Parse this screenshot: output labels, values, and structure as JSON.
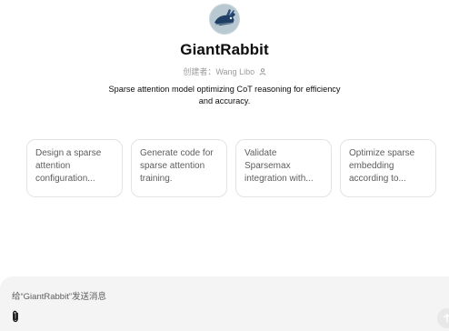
{
  "gpt": {
    "name": "GiantRabbit",
    "creator": "创建者：Wang Libo",
    "description": "Sparse attention model optimizing CoT reasoning for efficiency and accuracy."
  },
  "conversation_starters": [
    "Design a sparse attention configuration...",
    "Generate code for sparse attention training.",
    "Validate Sparsemax integration with...",
    "Optimize sparse embedding according to..."
  ],
  "composer": {
    "placeholder": "给“GiantRabbit”发送消息"
  },
  "icons": {
    "avatar": "rabbit-avatar-icon",
    "creator": "person-icon",
    "attach": "paperclip-icon",
    "send": "arrow-up-icon"
  }
}
